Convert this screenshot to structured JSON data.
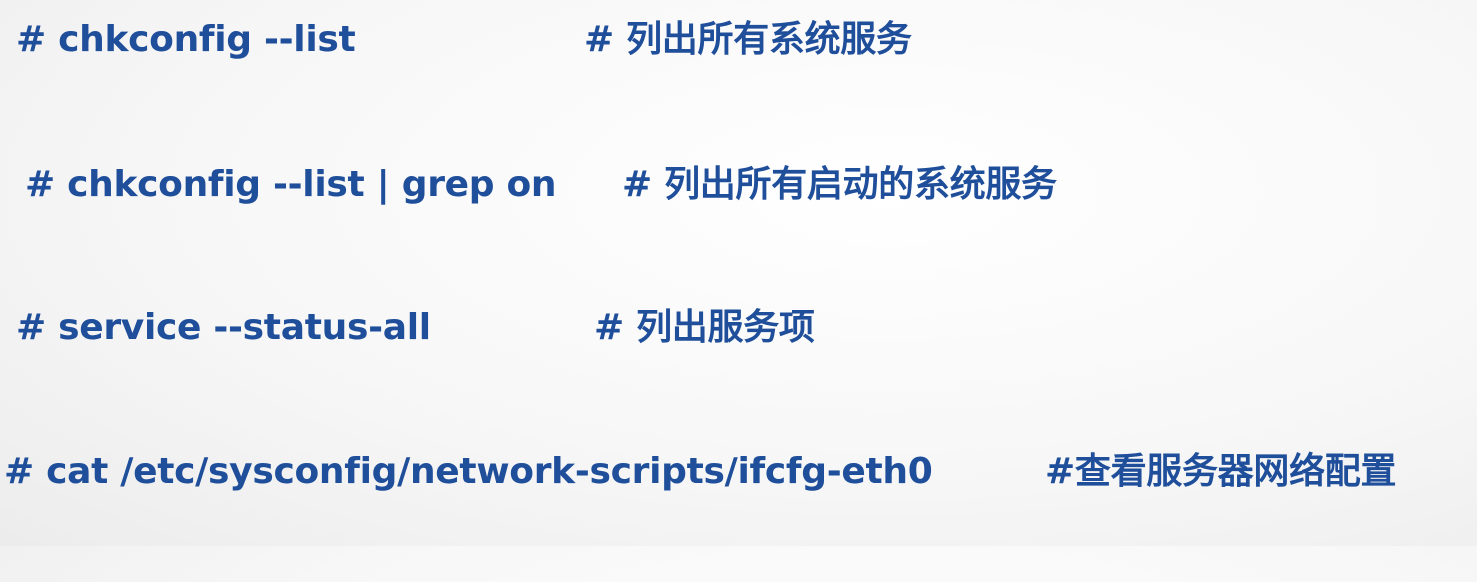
{
  "lines": [
    {
      "command": "# chkconfig --list",
      "comment": "# 列出所有系统服务"
    },
    {
      "command": "# chkconfig --list | grep on",
      "comment": "# 列出所有启动的系统服务"
    },
    {
      "command": "# service --status-all",
      "comment": "# 列出服务项"
    },
    {
      "command": "# cat /etc/sysconfig/network-scripts/ifcfg-eth0",
      "comment": "#查看服务器网络配置"
    }
  ],
  "colors": {
    "text": "#1f4e9a",
    "background": "#f7f7f7"
  }
}
